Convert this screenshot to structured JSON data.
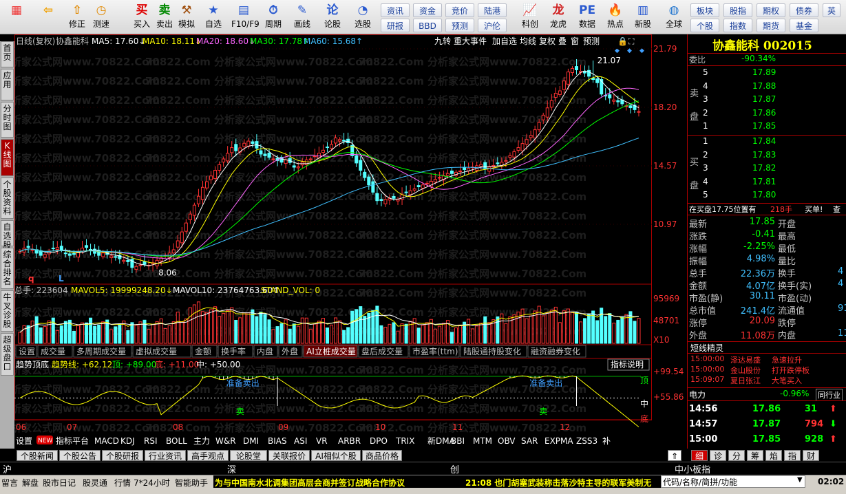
{
  "toolbar": {
    "items": [
      {
        "label": "",
        "icon": "windows-logo-icon",
        "name": "start-menu"
      },
      {
        "label": "",
        "icon": "back-arrow-icon",
        "name": "back"
      },
      {
        "label": "修正",
        "icon": "up-arrow-icon",
        "name": "correct"
      },
      {
        "label": "测速",
        "icon": "clock-icon",
        "name": "speed-test"
      },
      {
        "label": "买入",
        "icon": "buy-icon",
        "name": "buy"
      },
      {
        "label": "卖出",
        "icon": "sell-icon",
        "name": "sell"
      },
      {
        "label": "模拟",
        "icon": "hammer-icon",
        "name": "simulate"
      },
      {
        "label": "自选",
        "icon": "star-icon",
        "name": "watchlist"
      },
      {
        "label": "F10/F9",
        "icon": "f10-icon",
        "name": "f10"
      },
      {
        "label": "周期",
        "icon": "period-icon",
        "name": "period"
      },
      {
        "label": "画线",
        "icon": "pen-icon",
        "name": "draw-line"
      },
      {
        "label": "论股",
        "icon": "discuss-icon",
        "name": "discuss"
      },
      {
        "label": "选股",
        "icon": "select-icon",
        "name": "stock-select"
      },
      {
        "label": "科创",
        "icon": "sci-tech-icon",
        "name": "sci-tech"
      },
      {
        "label": "龙虎",
        "icon": "dragon-tiger-icon",
        "name": "dragon-tiger"
      },
      {
        "label": "数据",
        "icon": "pe-icon",
        "name": "data"
      },
      {
        "label": "热点",
        "icon": "hot-icon",
        "name": "hotspot"
      },
      {
        "label": "新股",
        "icon": "new-stock-icon",
        "name": "new-stock"
      },
      {
        "label": "全球",
        "icon": "globe-icon",
        "name": "global"
      }
    ],
    "small_buttons": {
      "row1": [
        "资讯",
        "资金",
        "竞价",
        "陆港"
      ],
      "row2": [
        "研报",
        "BBD",
        "预测",
        "沪伦"
      ],
      "right_row1": [
        "板块",
        "股指",
        "期权",
        "债券",
        "英"
      ],
      "right_row2": [
        "个股",
        "指数",
        "期货",
        "基金"
      ]
    }
  },
  "left_nav": [
    "首页",
    "应用",
    "分时图",
    "K线图",
    "个股资料",
    "自选股",
    "综合排名",
    "牛叉诊股",
    "超级盘口"
  ],
  "chart_header": {
    "period": "日线(复权)",
    "stock": "协鑫能科",
    "ma5": "MA5: 17.60",
    "ma10": "MA10: 18.11",
    "ma20": "MA20: 18.60",
    "ma30": "MA30: 17.78",
    "ma60": "MA60: 15.68",
    "right_tabs": [
      "九转",
      "重大事件",
      "加自选",
      "均线",
      "复权",
      "叠",
      "窗",
      "预测"
    ]
  },
  "price_axis": [
    "21.79",
    "18.20",
    "14.57",
    "10.97"
  ],
  "annotations": {
    "high": "21.07",
    "low": "8.06",
    "q": "q",
    "l": "L"
  },
  "volume_header": {
    "total": "总手: 223604",
    "mavol5": "MAVOL5: 19999248.20",
    "mavol10": "MAVOL10: 23764763.60",
    "stand": "STAND_VOL: 0"
  },
  "volume_axis": [
    "95969",
    "48701",
    "X10"
  ],
  "indicator_tabs": [
    "设置",
    "成交量",
    "多周期成交量",
    "虚拟成交量",
    "金额",
    "换手率",
    "内盘",
    "外盘",
    "AI立桩成交量",
    "盘后成交量",
    "市盈率(ttm)",
    "陆股通持股变化",
    "融资融券变化"
  ],
  "trend_header": {
    "title": "趋势顶底",
    "line": "趋势线: +62.12",
    "top": "顶: +89.00",
    "bottom": "底: +11.00",
    "mid": "中: +50.00",
    "explain": "指标说明"
  },
  "trend_axis": {
    "top": "+99.54",
    "mid": "+55.86",
    "top_label": "顶",
    "mid_label": "中",
    "bottom_label": "底"
  },
  "trend_labels": {
    "prep_sell": "准备卖出",
    "sell": "卖"
  },
  "months": [
    "06",
    "07",
    "08",
    "09",
    "10",
    "11",
    "12"
  ],
  "bottom_tabs1": [
    "设置",
    "NEW",
    "指标平台",
    "MACD",
    "KDJ",
    "RSI",
    "BOLL",
    "主力",
    "W&R",
    "DMI",
    "BIAS",
    "ASI",
    "VR",
    "ARBR",
    "DPO",
    "TRIX",
    "新DMA",
    "BBI",
    "MTM",
    "OBV",
    "SAR",
    "EXPMA",
    "ZSS3",
    "补"
  ],
  "bottom_tabs2": [
    "个股新闻",
    "个股公告",
    "个股研报",
    "行业资讯",
    "高手观点",
    "论股堂",
    "关联报价",
    "AI相似个股",
    "商品价格"
  ],
  "markets": [
    "沪",
    "深",
    "创",
    "中小板指"
  ],
  "status": {
    "items": [
      "留言",
      "解盘",
      "股市日记",
      "股灵通",
      "行情",
      "7*24小时",
      "智能助手"
    ],
    "news1": "为与中国南水北调集团高层会商并签订战略合作协议",
    "news2": "21:08 也门胡塞武装称击落沙特主导的联军美制无",
    "search": "代码/名称/简拼/功能",
    "time": "02:02"
  },
  "watermark": "70822.Com    分析家公式网www.70822.Com",
  "quote": {
    "name": "协鑫能科 002015",
    "weibi_label": "委比",
    "weibi": "-90.34%",
    "asks": [
      [
        "5",
        "17.89"
      ],
      [
        "4",
        "17.88"
      ],
      [
        "3",
        "17.87"
      ],
      [
        "2",
        "17.86"
      ],
      [
        "1",
        "17.85"
      ]
    ],
    "bids": [
      [
        "1",
        "17.84"
      ],
      [
        "2",
        "17.83"
      ],
      [
        "3",
        "17.82"
      ],
      [
        "4",
        "17.81"
      ],
      [
        "5",
        "17.80"
      ]
    ],
    "ask_side": "卖盘",
    "bid_side": "买盘",
    "inline": "在买盘17.75位置有",
    "inline_vol": "218手",
    "inline_buy": "买单!",
    "inline_check": "查",
    "stats": [
      [
        "最新",
        "17.85",
        "开盘",
        ""
      ],
      [
        "涨跌",
        "-0.41",
        "最高",
        ""
      ],
      [
        "涨幅",
        "-2.25%",
        "最低",
        ""
      ],
      [
        "振幅",
        "4.98%",
        "量比",
        ""
      ],
      [
        "总手",
        "22.36万",
        "换手",
        "4"
      ],
      [
        "金额",
        "4.07亿",
        "换手(实)",
        "4"
      ],
      [
        "市盈(静)",
        "30.11",
        "市盈(动)",
        ""
      ],
      [
        "总市值",
        "241.4亿",
        "流通值",
        "91"
      ],
      [
        "涨停",
        "20.09",
        "跌停",
        ""
      ],
      [
        "外盘",
        "11.08万",
        "内盘",
        "11"
      ]
    ],
    "elf_title": "短线精灵",
    "elf": [
      [
        "15:00:00",
        "泽达易盛",
        "急速拉升"
      ],
      [
        "15:00:00",
        "金山股份",
        "打开跌停板"
      ],
      [
        "15:09:07",
        "夏日张江",
        "大笔买入"
      ]
    ],
    "sector": "电力",
    "sector_change": "-0.96%",
    "sector_link": "同行业",
    "ticks": [
      [
        "14:56",
        "17.86",
        "31",
        "up"
      ],
      [
        "14:57",
        "17.87",
        "794",
        "down"
      ],
      [
        "15:00",
        "17.85",
        "928",
        "up"
      ]
    ],
    "tabs": [
      "细",
      "诊",
      "分",
      "筹",
      "焰",
      "指",
      "财"
    ]
  },
  "colors": {
    "up": "#ff3232",
    "down": "#54ffff",
    "ma5": "#ffffff",
    "ma10": "#ffff00",
    "ma20": "#ff66ff",
    "ma30": "#00ff00",
    "ma60": "#40c0ff"
  },
  "chart_data": {
    "type": "candlestick",
    "price_range": [
      8.06,
      21.79
    ],
    "high": 21.07,
    "low": 8.06,
    "ma_latest": {
      "MA5": 17.6,
      "MA10": 18.11,
      "MA20": 18.6,
      "MA30": 17.78,
      "MA60": 15.68
    },
    "volume_latest": {
      "total": 223604,
      "MAVOL5": 19999248.2,
      "MAVOL10": 23764763.6
    },
    "trend_latest": {
      "trend": 62.12,
      "top": 89.0,
      "bottom": 11.0,
      "mid": 50.0
    }
  }
}
